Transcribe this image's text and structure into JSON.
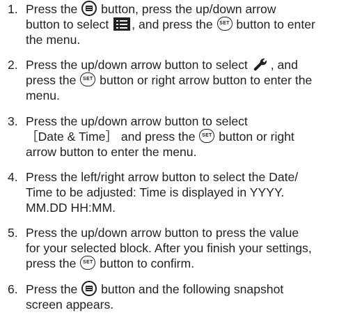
{
  "icons": {
    "menu_button": "menu-button-icon",
    "set_button": "set-button-icon",
    "setup_menu": "setup-menu-icon",
    "settings": "wrench-icon",
    "set_label": "SET"
  },
  "steps": [
    {
      "number": "1.",
      "lines": [
        [
          "Press the ",
          " button, press the up/down arrow"
        ],
        [
          "button to select ",
          ", and press the ",
          " button to enter"
        ],
        [
          "the menu."
        ]
      ]
    },
    {
      "number": "2.",
      "lines": [
        [
          "Press the up/down arrow button to select ",
          ", and"
        ],
        [
          "press the ",
          " button or right arrow button to enter the"
        ],
        [
          "menu."
        ]
      ]
    },
    {
      "number": "3.",
      "lines": [
        [
          "Press the up/down arrow button to select"
        ],
        [
          "［Date & Time］ and press the ",
          " button or right"
        ],
        [
          "arrow button to enter the menu."
        ]
      ]
    },
    {
      "number": "4.",
      "lines": [
        [
          "Press the left/right arrow button to select the Date/"
        ],
        [
          "Time to be adjusted: Time is displayed in YYYY."
        ],
        [
          "MM.DD HH:MM."
        ]
      ]
    },
    {
      "number": "5.",
      "lines": [
        [
          "Press the up/down arrow button to press the value"
        ],
        [
          "for your selected block. After you finish your settings,"
        ],
        [
          "press the ",
          " button to confirm."
        ]
      ]
    },
    {
      "number": "6.",
      "lines": [
        [
          "Press the ",
          " button and the following snapshot"
        ],
        [
          "screen appears."
        ]
      ]
    }
  ]
}
